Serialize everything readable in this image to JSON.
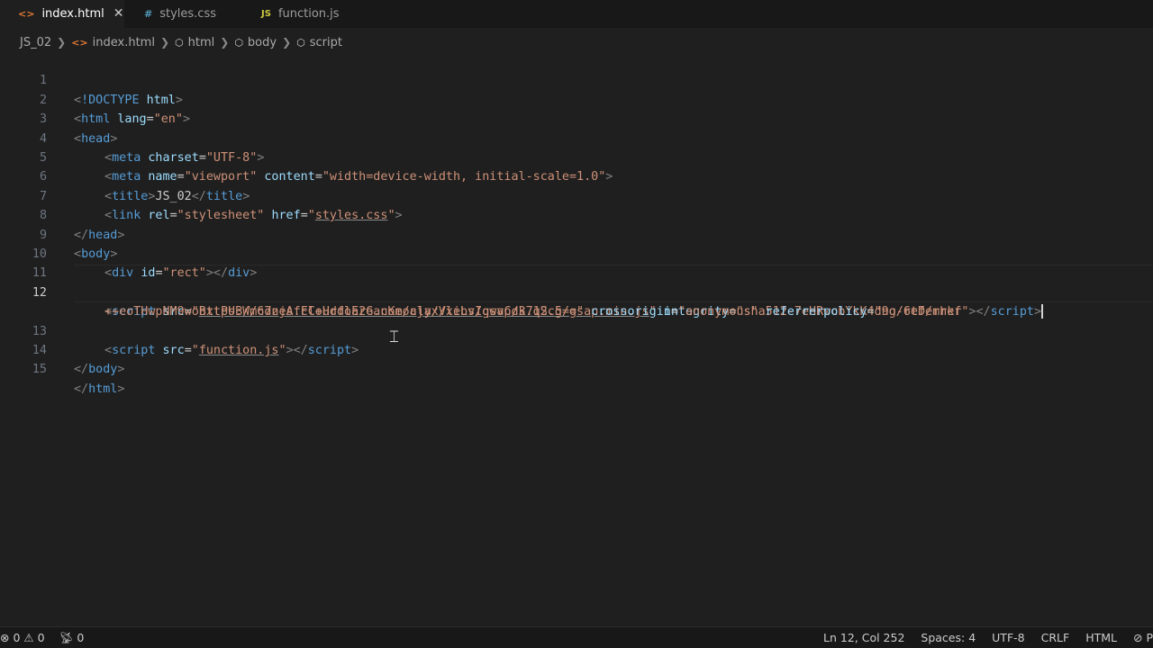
{
  "tabs": [
    {
      "icon": "<>",
      "label": "index.html",
      "close": "✕"
    },
    {
      "icon": "#",
      "label": "styles.css"
    },
    {
      "icon": "JS",
      "label": "function.js"
    }
  ],
  "breadcrumb": {
    "folder": "JS_02",
    "file": "index.html",
    "items": [
      "html",
      "body",
      "script"
    ]
  },
  "editor": {
    "line_numbers": [
      "1",
      "2",
      "3",
      "4",
      "5",
      "6",
      "7",
      "8",
      "9",
      "10",
      "11",
      "12",
      "13",
      "14",
      "15"
    ],
    "code": {
      "doctype": "!DOCTYPE",
      "html_tag": "html",
      "head_tag": "head",
      "meta_tag": "meta",
      "title_tag": "title",
      "link_tag": "link",
      "body_tag": "body",
      "div_tag": "div",
      "script_tag": "script",
      "lang_attr": "lang",
      "lang_val": "\"en\"",
      "charset_attr": "charset",
      "charset_val": "\"UTF-8\"",
      "name_attr": "name",
      "name_val": "\"viewport\"",
      "content_attr": "content",
      "content_val": "\"width=device-width, initial-scale=1.0\"",
      "title_text": "JS_02",
      "rel_attr": "rel",
      "rel_val": "\"stylesheet\"",
      "href_attr": "href",
      "href_q1": "\"",
      "href_val": "styles.css",
      "href_q2": "\"",
      "id_attr": "id",
      "id_val": "\"rect\"",
      "src_attr": "src",
      "gsap_q1": "\"",
      "gsap_url": "https://cdnjs.cloudflare.com/ajax/libs/gsap/3.12.5/gsap.min.js",
      "gsap_q2": "\"",
      "integrity_attr": "integrity",
      "integrity_val1": "\"sha512-7eHRwcbYkK4d9g/6tD/mhkf",
      "integrity_val2": "++eoTHwpNM9woBxtPUBWm67zeAfFC+HrdoE2GanKeocly/VxeLvIqwvCdk7qScg==\"",
      "crossorigin_attr": "crossorigin",
      "crossorigin_val": "\"anonymous\"",
      "referrer_attr": "referrerpolicy",
      "referrer_val": "\"no-referrer\"",
      "fn_q1": "\"",
      "fn_src": "function.js",
      "fn_q2": "\""
    }
  },
  "status": {
    "errors": "0",
    "warnings": "0",
    "ports": "0",
    "position": "Ln 12, Col 252",
    "spaces": "Spaces: 4",
    "encoding": "UTF-8",
    "eol": "CRLF",
    "language": "HTML",
    "extra": "P"
  }
}
